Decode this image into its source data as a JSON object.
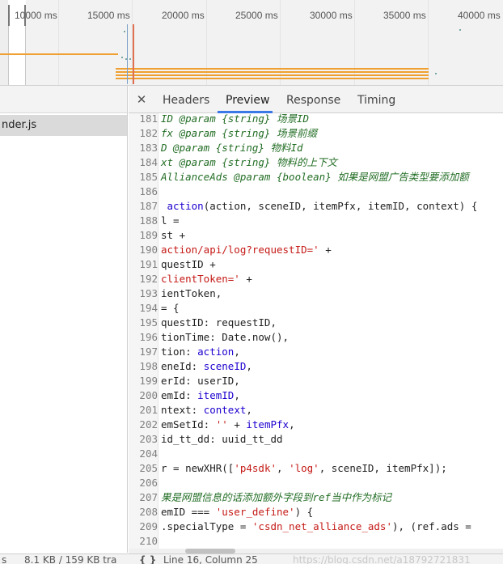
{
  "timeline": {
    "ticks": [
      "10000 ms",
      "15000 ms",
      "20000 ms",
      "25000 ms",
      "30000 ms",
      "35000 ms",
      "40000 ms"
    ]
  },
  "left_panel": {
    "file_name": "nder.js"
  },
  "tabs": {
    "close_symbol": "✕",
    "items": [
      "Headers",
      "Preview",
      "Response",
      "Timing"
    ],
    "active": "Preview"
  },
  "code": {
    "lines": [
      {
        "n": "181",
        "parts": [
          [
            "cm",
            "ID @param {string} 场景ID"
          ]
        ]
      },
      {
        "n": "182",
        "parts": [
          [
            "cm",
            "fx @param {string} 场景前缀"
          ]
        ]
      },
      {
        "n": "183",
        "parts": [
          [
            "cm",
            "D @param {string} 物料Id"
          ]
        ]
      },
      {
        "n": "184",
        "parts": [
          [
            "cm",
            "xt @param {string} 物料的上下文"
          ]
        ]
      },
      {
        "n": "185",
        "parts": [
          [
            "cm",
            "AllianceAds @param {boolean} 如果是网盟广告类型要添加额"
          ]
        ]
      },
      {
        "n": "186",
        "parts": [
          [
            "pl",
            ""
          ]
        ]
      },
      {
        "n": "187",
        "parts": [
          [
            "pl",
            " "
          ],
          [
            "fn",
            "action"
          ],
          [
            "pl",
            "(action, sceneID, itemPfx, itemID, context) {"
          ]
        ]
      },
      {
        "n": "188",
        "parts": [
          [
            "pl",
            "l ="
          ]
        ]
      },
      {
        "n": "189",
        "parts": [
          [
            "pl",
            "st +"
          ]
        ]
      },
      {
        "n": "190",
        "parts": [
          [
            "str",
            "action/api/log?requestID='"
          ],
          [
            "pl",
            " +"
          ]
        ]
      },
      {
        "n": "191",
        "parts": [
          [
            "pl",
            "questID +"
          ]
        ]
      },
      {
        "n": "192",
        "parts": [
          [
            "str",
            "clientToken='"
          ],
          [
            "pl",
            " +"
          ]
        ]
      },
      {
        "n": "193",
        "parts": [
          [
            "pl",
            "ientToken,"
          ]
        ]
      },
      {
        "n": "194",
        "parts": [
          [
            "pl",
            "= {"
          ]
        ]
      },
      {
        "n": "195",
        "parts": [
          [
            "pl",
            "questID: requestID,"
          ]
        ]
      },
      {
        "n": "196",
        "parts": [
          [
            "pl",
            "tionTime: Date.now(),"
          ]
        ]
      },
      {
        "n": "197",
        "parts": [
          [
            "pl",
            "tion: "
          ],
          [
            "fn",
            "action"
          ],
          [
            "pl",
            ","
          ]
        ]
      },
      {
        "n": "198",
        "parts": [
          [
            "pl",
            "eneId: "
          ],
          [
            "fn",
            "sceneID"
          ],
          [
            "pl",
            ","
          ]
        ]
      },
      {
        "n": "199",
        "parts": [
          [
            "pl",
            "erId: userID,"
          ]
        ]
      },
      {
        "n": "200",
        "parts": [
          [
            "pl",
            "emId: "
          ],
          [
            "fn",
            "itemID"
          ],
          [
            "pl",
            ","
          ]
        ]
      },
      {
        "n": "201",
        "parts": [
          [
            "pl",
            "ntext: "
          ],
          [
            "fn",
            "context"
          ],
          [
            "pl",
            ","
          ]
        ]
      },
      {
        "n": "202",
        "parts": [
          [
            "pl",
            "emSetId: "
          ],
          [
            "str",
            "''"
          ],
          [
            "pl",
            " + "
          ],
          [
            "fn",
            "itemPfx"
          ],
          [
            "pl",
            ","
          ]
        ]
      },
      {
        "n": "203",
        "parts": [
          [
            "pl",
            "id_tt_dd: uuid_tt_dd"
          ]
        ]
      },
      {
        "n": "204",
        "parts": [
          [
            "pl",
            ""
          ]
        ]
      },
      {
        "n": "205",
        "parts": [
          [
            "pl",
            "r = newXHR(["
          ],
          [
            "str",
            "'p4sdk'"
          ],
          [
            "pl",
            ", "
          ],
          [
            "str",
            "'log'"
          ],
          [
            "pl",
            ", sceneID, itemPfx]);"
          ]
        ]
      },
      {
        "n": "206",
        "parts": [
          [
            "pl",
            ""
          ]
        ]
      },
      {
        "n": "207",
        "parts": [
          [
            "cm",
            "果是网盟信息的话添加额外字段到ref当中作为标记"
          ]
        ]
      },
      {
        "n": "208",
        "parts": [
          [
            "pl",
            "emID === "
          ],
          [
            "str",
            "'user_define'"
          ],
          [
            "pl",
            ") {"
          ]
        ]
      },
      {
        "n": "209",
        "parts": [
          [
            "pl",
            ".specialType = "
          ],
          [
            "str",
            "'csdn_net_alliance_ads'"
          ],
          [
            "pl",
            "), (ref.ads ="
          ]
        ]
      },
      {
        "n": "210",
        "parts": [
          [
            "pl",
            ""
          ]
        ]
      }
    ]
  },
  "status": {
    "left": "s",
    "size": "8.1 KB / 159 KB tra",
    "braces": "{ }",
    "position": "Line 16, Column 25",
    "watermark": "https://blog.csdn.net/a18792721831"
  },
  "colors": {
    "accent": "#3b78e7",
    "comment": "#236e25",
    "string": "#c41a16",
    "identifier": "#1c00cf",
    "timeline_bar": "#f0a030"
  }
}
